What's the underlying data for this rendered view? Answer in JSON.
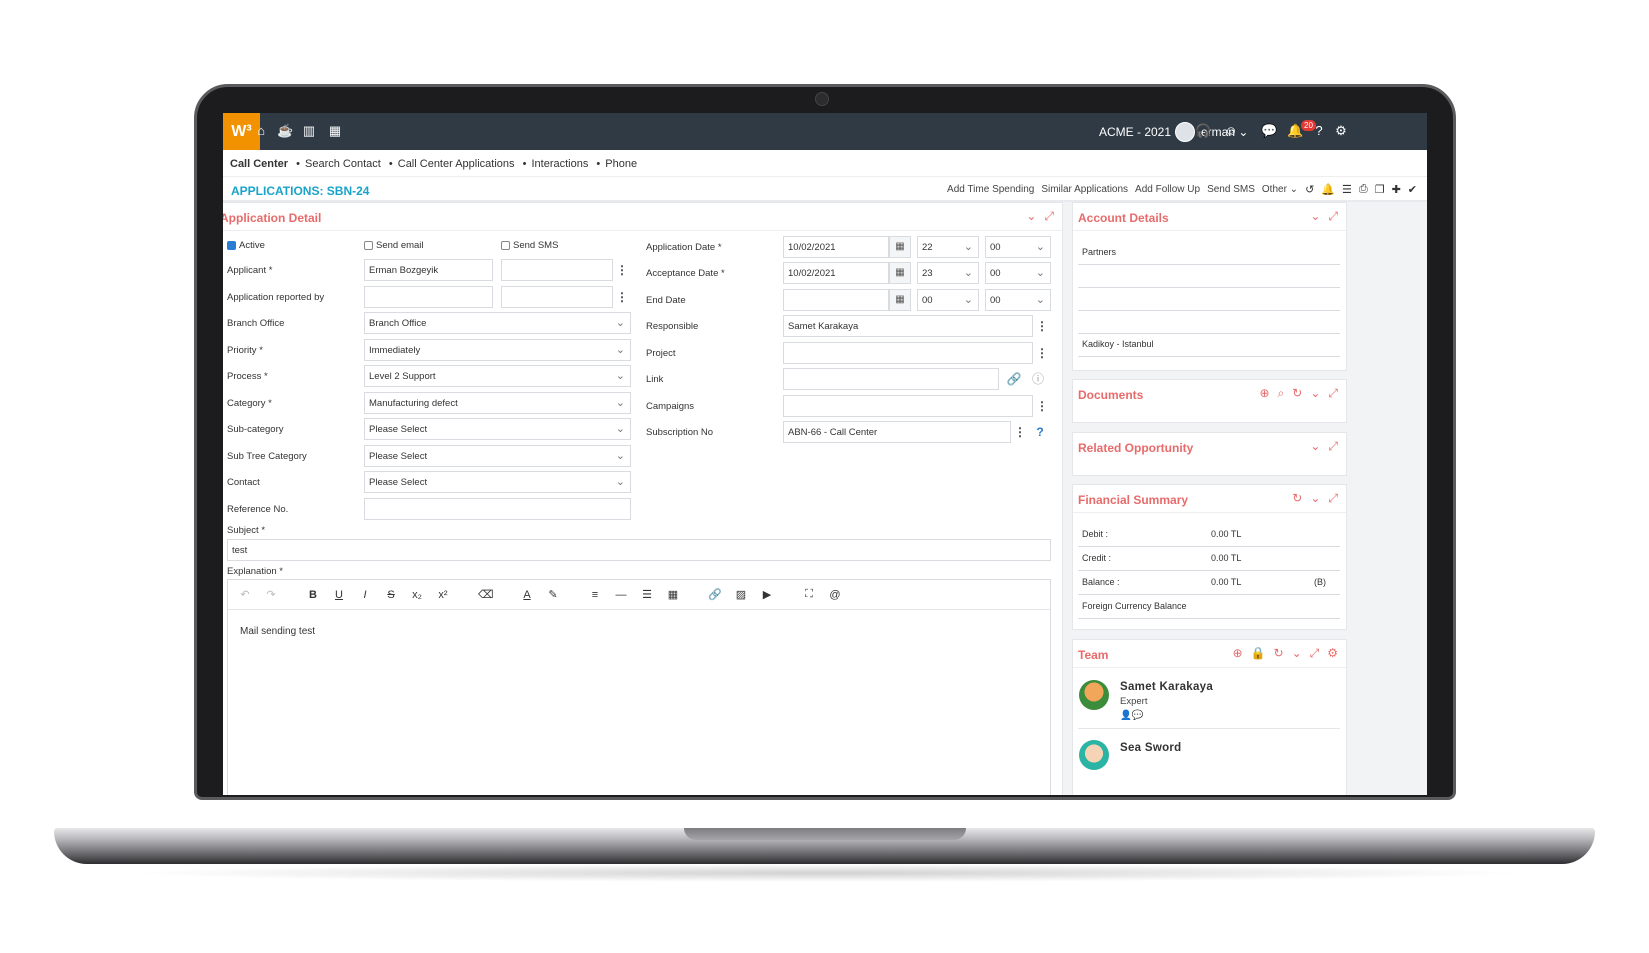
{
  "topbar": {
    "logo": "W³",
    "company": "ACME - 2021",
    "user": "erman",
    "notification_count": "20",
    "icons": [
      "home-icon",
      "coffee-icon",
      "chart-icon",
      "calendar-icon",
      "headset-icon",
      "chat-face-icon",
      "message-icon",
      "bell-icon",
      "help-icon",
      "gear-icon"
    ]
  },
  "breadcrumb": [
    "Call Center",
    "Search Contact",
    "Call Center Applications",
    "Interactions",
    "Phone"
  ],
  "title": "APPLICATIONS: SBN-24",
  "actions": [
    "Add Time Spending",
    "Similar Applications",
    "Add Follow Up",
    "Send SMS",
    "Other"
  ],
  "detail": {
    "title": "Application Detail",
    "active_label": "Active",
    "send_email_label": "Send email",
    "send_sms_label": "Send SMS",
    "applicant_label": "Applicant *",
    "applicant_value": "Erman Bozgeyik",
    "reported_label": "Application reported by",
    "branch_label": "Branch Office",
    "branch_value": "Branch Office",
    "priority_label": "Priority *",
    "priority_value": "Immediately",
    "process_label": "Process *",
    "process_value": "Level 2 Support",
    "category_label": "Category *",
    "category_value": "Manufacturing defect",
    "subcategory_label": "Sub-category",
    "subcategory_value": "Please Select",
    "subtree_label": "Sub Tree Category",
    "subtree_value": "Please Select",
    "contact_label": "Contact",
    "contact_value": "Please Select",
    "reference_label": "Reference No.",
    "subject_label": "Subject *",
    "subject_value": "test",
    "explanation_label": "Explanation *",
    "explanation_value": "Mail sending test",
    "app_date_label": "Application Date *",
    "app_date_value": "10/02/2021",
    "app_hour": "22",
    "app_min": "00",
    "acc_date_label": "Acceptance Date *",
    "acc_date_value": "10/02/2021",
    "acc_hour": "23",
    "acc_min": "00",
    "end_date_label": "End Date",
    "end_hour": "00",
    "end_min": "00",
    "responsible_label": "Responsible",
    "responsible_value": "Samet Karakaya",
    "project_label": "Project",
    "link_label": "Link",
    "campaigns_label": "Campaigns",
    "subscription_label": "Subscription No",
    "subscription_value": "ABN-66 - Call Center"
  },
  "account": {
    "title": "Account Details",
    "partners": "Partners",
    "location": "Kadikoy - Istanbul"
  },
  "documents": {
    "title": "Documents"
  },
  "related": {
    "title": "Related Opportunity"
  },
  "financial": {
    "title": "Financial Summary",
    "debit_label": "Debit :",
    "debit_value": "0.00 TL",
    "credit_label": "Credit :",
    "credit_value": "0.00 TL",
    "balance_label": "Balance :",
    "balance_value": "0.00 TL",
    "balance_flag": "(B)",
    "foreign_label": "Foreign Currency Balance"
  },
  "team": {
    "title": "Team",
    "members": [
      {
        "name": "Samet Karakaya",
        "role": "Expert"
      },
      {
        "name": "Sea Sword",
        "role": ""
      }
    ]
  }
}
